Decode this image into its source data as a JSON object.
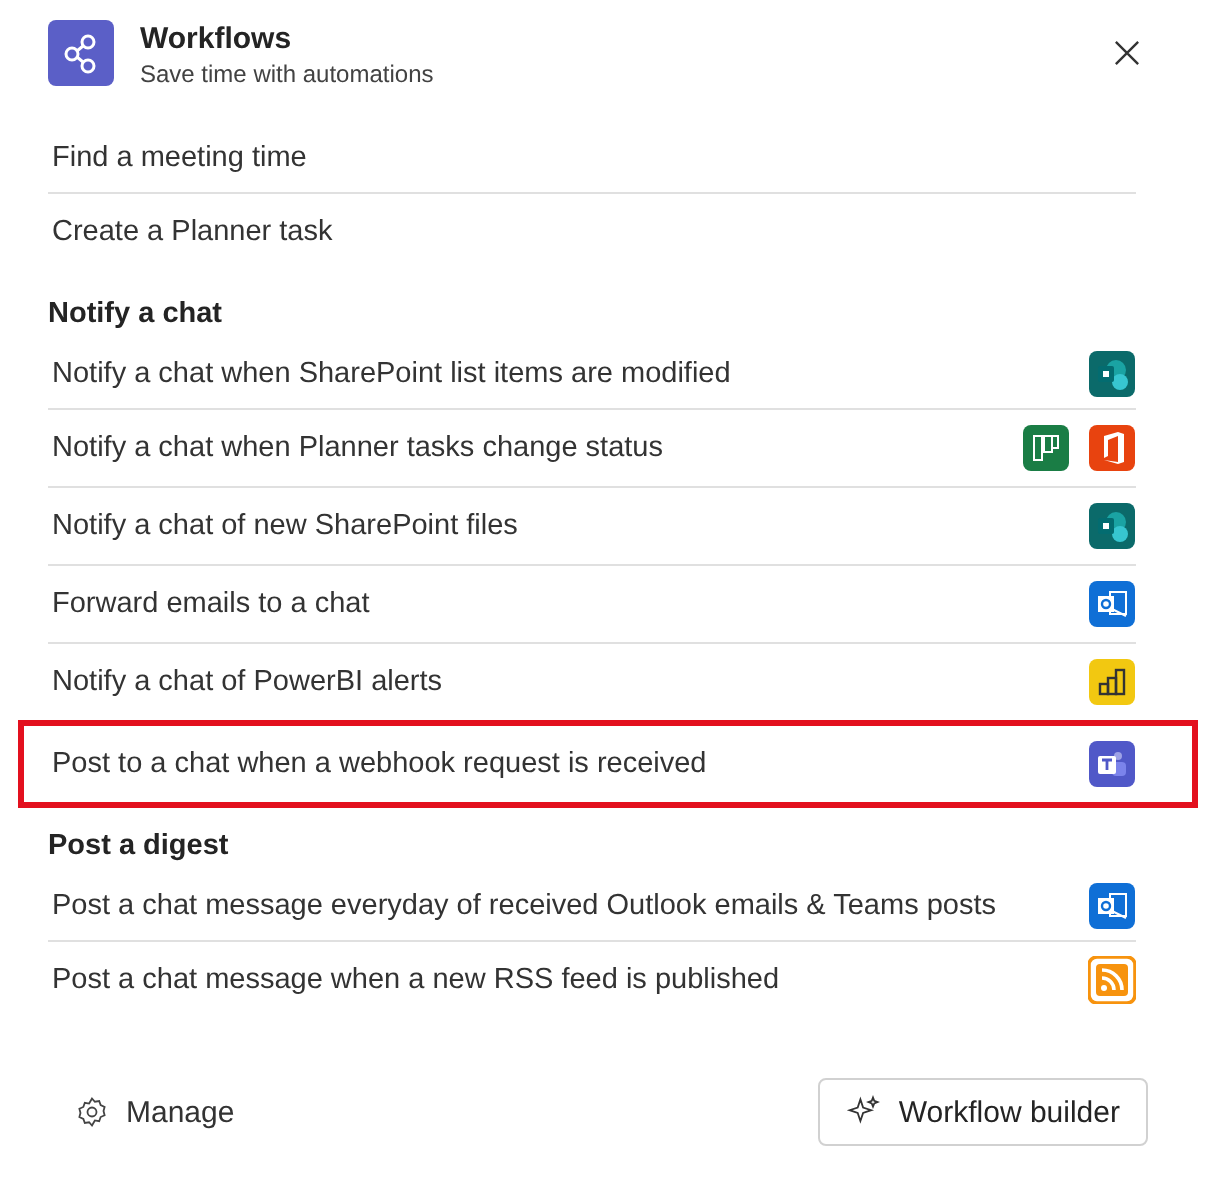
{
  "header": {
    "title": "Workflows",
    "subtitle": "Save time with automations"
  },
  "quick_items": [
    {
      "label": "Find a meeting time"
    },
    {
      "label": "Create a Planner task"
    }
  ],
  "sections": [
    {
      "title": "Notify a chat",
      "items": [
        {
          "label": "Notify a chat when SharePoint list items are modified",
          "apps": [
            {
              "kind": "sharepoint"
            }
          ],
          "highlighted": false
        },
        {
          "label": "Notify a chat when Planner tasks change status",
          "apps": [
            {
              "kind": "planner"
            },
            {
              "kind": "office"
            }
          ],
          "highlighted": false
        },
        {
          "label": "Notify a chat of new SharePoint files",
          "apps": [
            {
              "kind": "sharepoint"
            }
          ],
          "highlighted": false
        },
        {
          "label": "Forward emails to a chat",
          "apps": [
            {
              "kind": "outlook"
            }
          ],
          "highlighted": false
        },
        {
          "label": "Notify a chat of PowerBI alerts",
          "apps": [
            {
              "kind": "powerbi"
            }
          ],
          "highlighted": false
        },
        {
          "label": "Post to a chat when a webhook request is received",
          "apps": [
            {
              "kind": "teams"
            }
          ],
          "highlighted": true
        }
      ]
    },
    {
      "title": "Post a digest",
      "items": [
        {
          "label": "Post a chat message everyday of received Outlook emails & Teams posts",
          "apps": [
            {
              "kind": "outlook"
            }
          ],
          "highlighted": false
        },
        {
          "label": "Post a chat message when a new RSS feed is published",
          "apps": [
            {
              "kind": "rss"
            }
          ],
          "highlighted": false
        }
      ]
    }
  ],
  "footer": {
    "manage": "Manage",
    "builder": "Workflow builder"
  }
}
